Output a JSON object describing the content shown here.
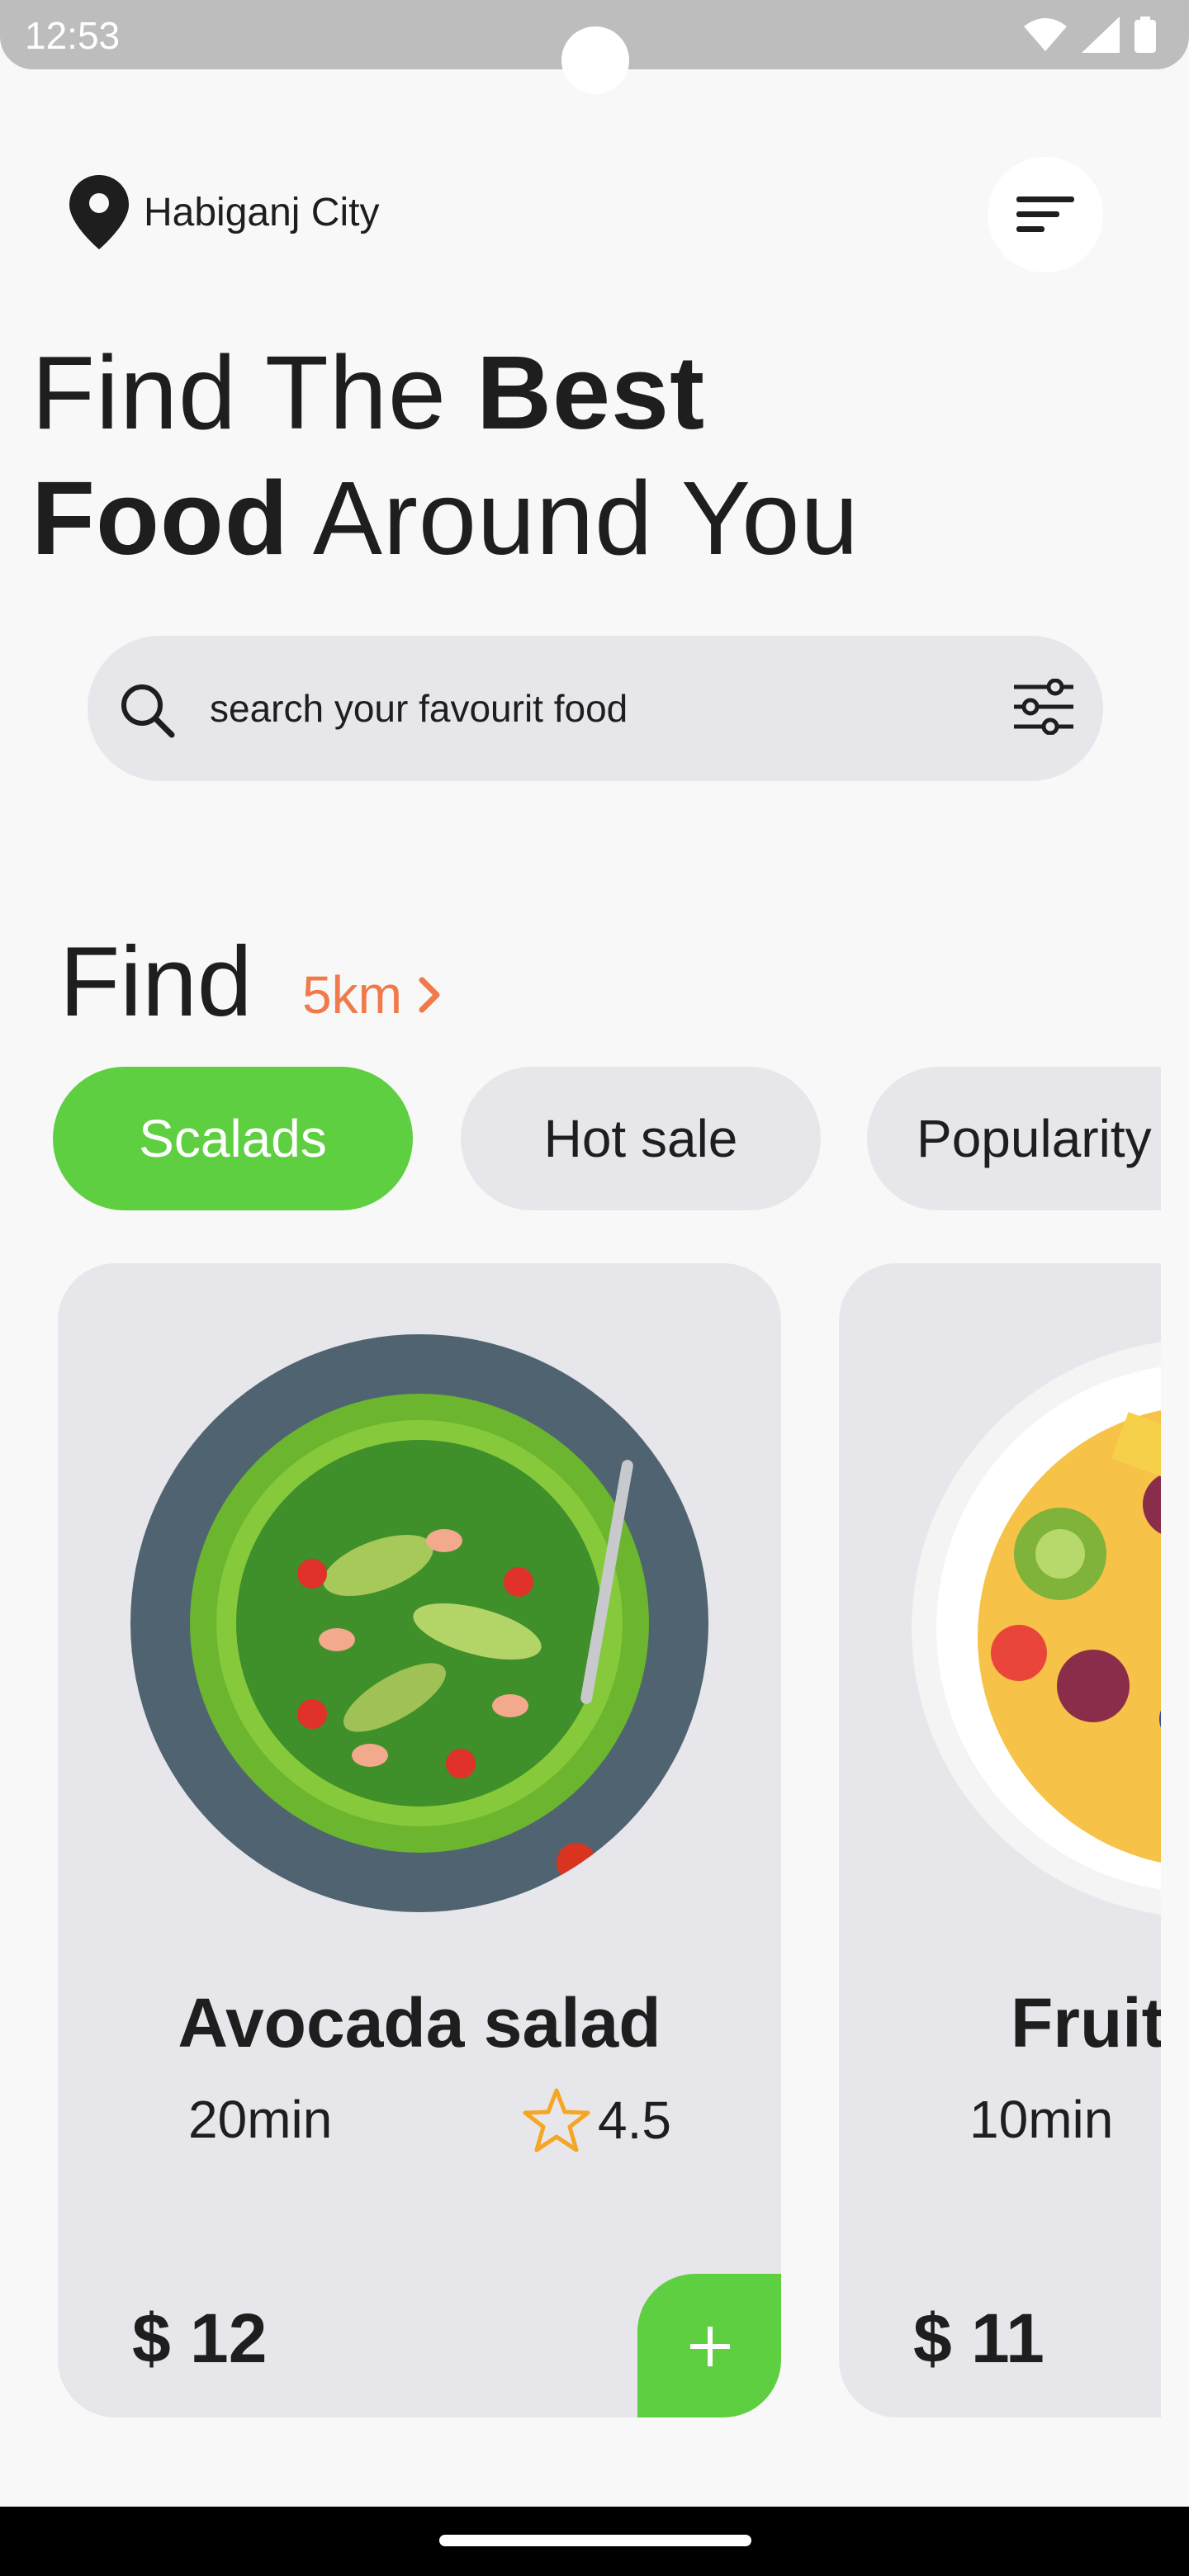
{
  "status_bar": {
    "time": "12:53",
    "icons": [
      "wifi-icon",
      "signal-icon",
      "battery-icon"
    ]
  },
  "location": {
    "label": "Habiganj City",
    "icon": "location-pin-icon"
  },
  "menu": {
    "icon": "sort-menu-icon"
  },
  "headline": {
    "line1_light": "Find The ",
    "line1_bold": "Best",
    "line2_bold": "Food",
    "line2_light": " Around You"
  },
  "search": {
    "placeholder": "search your favourit food",
    "value": ""
  },
  "find": {
    "title": "Find",
    "distance": "5km"
  },
  "chips": [
    {
      "label": "Scalads",
      "active": true
    },
    {
      "label": "Hot sale",
      "active": false
    },
    {
      "label": "Popularity",
      "active": false
    }
  ],
  "cards": [
    {
      "name": "Avocada salad",
      "time": "20min",
      "rating": "4.5",
      "price": "$ 12"
    },
    {
      "name": "Fruit",
      "time": "10min",
      "price": "$ 11"
    }
  ],
  "colors": {
    "accent_green": "#5ecf41",
    "accent_orange": "#f07a4a",
    "card_bg": "#e7e6ea",
    "page_bg": "#f8f8f8"
  }
}
